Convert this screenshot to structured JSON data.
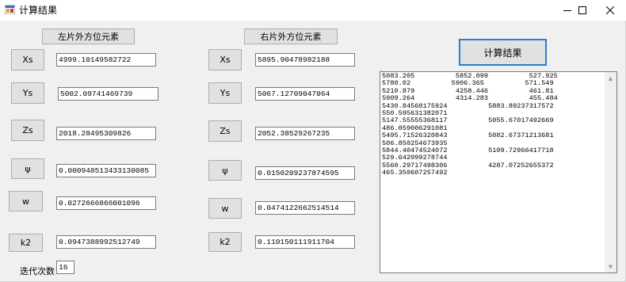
{
  "window": {
    "title": "计算结果"
  },
  "left": {
    "header": "左片外方位元素",
    "rows": [
      {
        "label": "Xs",
        "value": "4999.10149582722"
      },
      {
        "label": "Ys",
        "value": "5002.09741469739"
      },
      {
        "label": "Zs",
        "value": "2018.28495309826"
      },
      {
        "label": "ψ",
        "value": "0.000948513433130085"
      },
      {
        "label": "w",
        "value": "0.0272666866001096"
      },
      {
        "label": "k2",
        "value": "0.0947388992512749"
      }
    ]
  },
  "right": {
    "header": "右片外方位元素",
    "rows": [
      {
        "label": "Xs",
        "value": "5895.90478982188"
      },
      {
        "label": "Ys",
        "value": "5067.12709047064"
      },
      {
        "label": "Zs",
        "value": "2052.38529267235"
      },
      {
        "label": "ψ",
        "value": "0.0150209237874595"
      },
      {
        "label": "w",
        "value": "0.0474122662514514"
      },
      {
        "label": "k2",
        "value": "0.110150111911704"
      }
    ]
  },
  "iterations": {
    "label": "迭代次数",
    "value": "16"
  },
  "calculate_button": "计算结果",
  "result_lines": [
    "5083.205          5852.099          527.925",
    "5780.02          5906.365          571.549",
    "5210.879          4258.446          461.81",
    "5909.264          4314.283          455.484",
    "5430.84560175924          5883.89237317572",
    "550.595631382071",
    "5147.55555368117          5055.67017492669",
    "486.059006291081",
    "5495.71526320843          5082.67371213681",
    "506.850254673935",
    "5844.40474524072          5109.72966417718",
    "529.642099278744",
    "5560.29717498306          4287.07252655372",
    "465.350607257492"
  ]
}
